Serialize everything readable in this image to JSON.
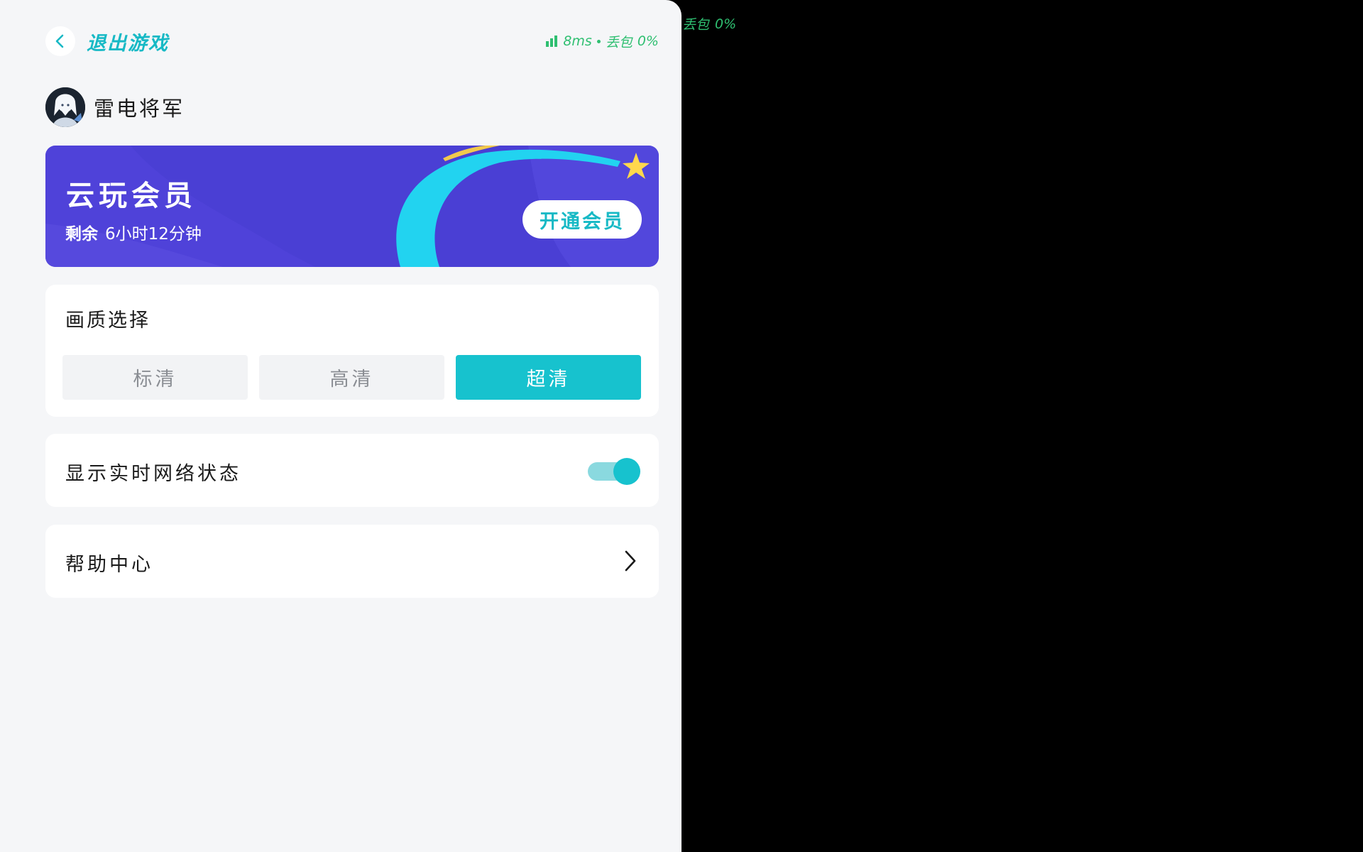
{
  "background": {
    "net_status": {
      "network_label": "丢包",
      "loss": "0%"
    }
  },
  "header": {
    "back_icon": "chevron-left-icon",
    "exit_label": "退出游戏",
    "net_status": {
      "signal_icon": "signal-bars-icon",
      "latency": "8ms",
      "loss_label": "丢包",
      "loss": "0%"
    }
  },
  "user": {
    "name": "雷电将军",
    "avatar_icon": "avatar"
  },
  "member": {
    "title": "云玩会员",
    "remain_label": "剩余",
    "remain_value": "6小时12分钟",
    "open_button": "开通会员"
  },
  "quality": {
    "title": "画质选择",
    "options": [
      "标清",
      "高清",
      "超清"
    ],
    "selected": "超清"
  },
  "network_display": {
    "label": "显示实时网络状态",
    "enabled": true
  },
  "help": {
    "label": "帮助中心",
    "chevron_icon": "chevron-right-icon"
  },
  "colors": {
    "accent": "#17c2ce",
    "member_bg": "#4a3fd4",
    "status_green": "#2fbf71",
    "panel_bg": "#f5f6f8"
  }
}
